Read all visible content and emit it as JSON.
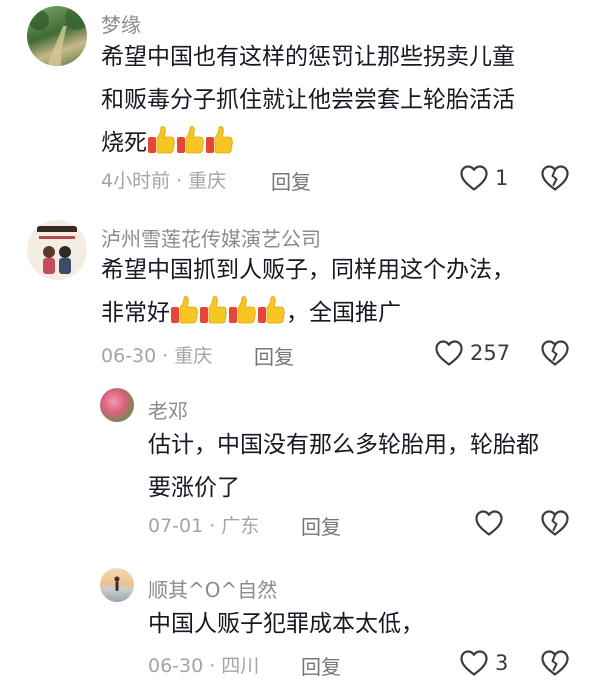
{
  "comments": [
    {
      "username": "梦缘",
      "text_line1": "希望中国也有这样的惩罚让那些拐卖儿童",
      "text_line2": "和贩毒分子抓住就让他尝尝套上轮胎活活",
      "text_line3": "烧死",
      "thumbs": 3,
      "time": "4小时前",
      "location": "重庆",
      "reply_label": "回复",
      "likes": "1",
      "avatar_icon": "forest-path-avatar"
    },
    {
      "username": "泸州雪莲花传媒演艺公司",
      "text_line1": "希望中国抓到人贩子，同样用这个办法，",
      "text_line2_prefix": "非常好",
      "text_line2_suffix": "，全国推广",
      "thumbs": 4,
      "time": "06-30",
      "location": "重庆",
      "reply_label": "回复",
      "likes": "257",
      "avatar_icon": "couple-poster-avatar"
    },
    {
      "username": "老邓",
      "text_line1": "估计，中国没有那么多轮胎用，轮胎都",
      "text_line2": "要涨价了",
      "time": "07-01",
      "location": "广东",
      "reply_label": "回复",
      "likes": "",
      "avatar_icon": "flowers-avatar"
    },
    {
      "username": "顺其^O^自然",
      "text_line1": "中国人贩子犯罪成本太低，",
      "time": "06-30",
      "location": "四川",
      "reply_label": "回复",
      "likes": "3",
      "avatar_icon": "beach-sunset-avatar"
    }
  ],
  "icons": {
    "like": "heart-outline-icon",
    "dislike": "broken-heart-outline-icon",
    "thumb": "thumbs-up-emoji"
  },
  "colors": {
    "username": "#8a8b91",
    "meta": "#a3a4a8",
    "thumb_yellow": "#f7c623",
    "thumb_red": "#e8443a"
  }
}
